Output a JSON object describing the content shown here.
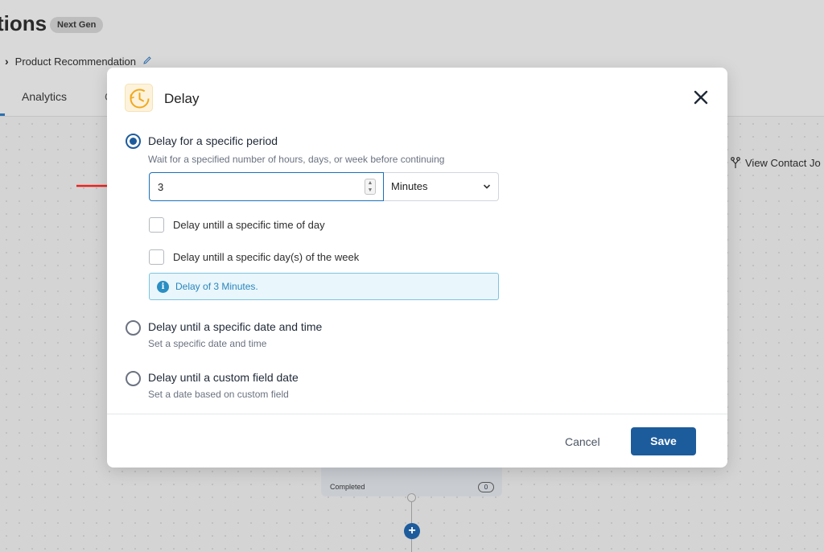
{
  "background": {
    "page_title": "tions",
    "badge": "Next Gen",
    "breadcrumb_chevron": "›",
    "breadcrumb": "Product Recommendation",
    "edit_icon": "pencil-icon",
    "tab_active": "Analytics",
    "tab_partial": "C",
    "view_contact": "View Contact Jo",
    "node_status": "Completed",
    "node_count": "0",
    "add_label": "+"
  },
  "modal": {
    "title": "Delay",
    "icon": "clock-icon",
    "options": [
      {
        "title": "Delay for a specific period",
        "description": "Wait for a specified number of hours, days, or week before continuing",
        "selected": true
      },
      {
        "title": "Delay until a specific date and time",
        "description": "Set a specific date and time",
        "selected": false
      },
      {
        "title": "Delay until a custom field date",
        "description": "Set a date based on custom field",
        "selected": false
      }
    ],
    "period": {
      "value": "3",
      "unit": "Minutes"
    },
    "checkboxes": [
      {
        "label": "Delay untill a specific time of day",
        "checked": false
      },
      {
        "label": "Delay untill a specific day(s) of the week",
        "checked": false
      }
    ],
    "info": {
      "icon_glyph": "i",
      "text": "Delay of 3 Minutes."
    },
    "footer": {
      "cancel": "Cancel",
      "save": "Save"
    }
  },
  "colors": {
    "primary": "#1d5c9c",
    "info_text": "#2a86bd",
    "annotation_arrow": "#e8231f"
  }
}
